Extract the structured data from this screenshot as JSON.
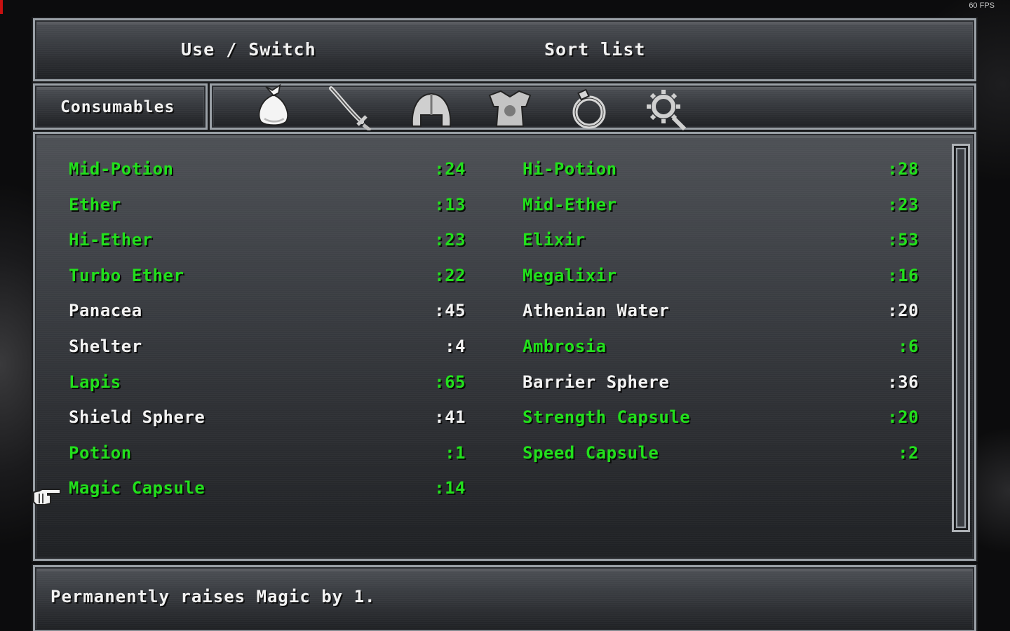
{
  "fps": "60 FPS",
  "menu": {
    "use_switch": "Use / Switch",
    "sort_list": "Sort list"
  },
  "category": {
    "label": "Consumables",
    "icons": [
      "bag-icon",
      "sword-icon",
      "helmet-icon",
      "armor-icon",
      "ring-icon",
      "gear-icon"
    ]
  },
  "items_left": [
    {
      "name": "Mid-Potion",
      "qty": ":24",
      "color": "#22e01c"
    },
    {
      "name": "Ether",
      "qty": ":13",
      "color": "#22e01c"
    },
    {
      "name": "Hi-Ether",
      "qty": ":23",
      "color": "#22e01c"
    },
    {
      "name": "Turbo Ether",
      "qty": ":22",
      "color": "#22e01c"
    },
    {
      "name": "Panacea",
      "qty": ":45",
      "color": "#f2f2f2"
    },
    {
      "name": "Shelter",
      "qty": ":4",
      "color": "#f2f2f2"
    },
    {
      "name": "Lapis",
      "qty": ":65",
      "color": "#22e01c"
    },
    {
      "name": "Shield Sphere",
      "qty": ":41",
      "color": "#f2f2f2"
    },
    {
      "name": "Potion",
      "qty": ":1",
      "color": "#22e01c"
    },
    {
      "name": "Magic Capsule",
      "qty": ":14",
      "color": "#22e01c"
    }
  ],
  "items_right": [
    {
      "name": "Hi-Potion",
      "qty": ":28",
      "color": "#22e01c"
    },
    {
      "name": "Mid-Ether",
      "qty": ":23",
      "color": "#22e01c"
    },
    {
      "name": "Elixir",
      "qty": ":53",
      "color": "#22e01c"
    },
    {
      "name": "Megalixir",
      "qty": ":16",
      "color": "#22e01c"
    },
    {
      "name": "Athenian Water",
      "qty": ":20",
      "color": "#f2f2f2"
    },
    {
      "name": "Ambrosia",
      "qty": ":6",
      "color": "#22e01c"
    },
    {
      "name": "Barrier Sphere",
      "qty": ":36",
      "color": "#f2f2f2"
    },
    {
      "name": "Strength Capsule",
      "qty": ":20",
      "color": "#22e01c"
    },
    {
      "name": "Speed Capsule",
      "qty": ":2",
      "color": "#22e01c"
    }
  ],
  "help_text": "Permanently raises Magic by 1."
}
